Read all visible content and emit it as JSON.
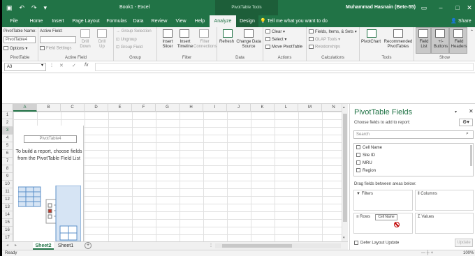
{
  "titlebar": {
    "doc_title": "Book1 - Excel",
    "context_title": "PivotTable Tools",
    "user_name": "Muhammad Hasnain (Bete-55)",
    "qat": [
      "save-icon",
      "undo-icon",
      "redo-icon"
    ],
    "window_buttons": [
      "restore-ribbon-icon",
      "minimize-icon",
      "maximize-icon",
      "close-icon"
    ]
  },
  "tabs": [
    "File",
    "Home",
    "Insert",
    "Page Layout",
    "Formulas",
    "Data",
    "Review",
    "View",
    "Help",
    "Analyze",
    "Design"
  ],
  "active_tab": "Analyze",
  "tell_me": "Tell me what you want to do",
  "share": "Share",
  "ribbon": {
    "pivottable": {
      "name_label": "PivotTable Name:",
      "name_value": "PivotTable4",
      "options": "Options",
      "group": "PivotTable"
    },
    "active_field": {
      "label": "Active Field:",
      "field_settings": "Field Settings",
      "drill_down": [
        "Drill",
        "Down"
      ],
      "drill_up": [
        "Drill",
        "Up"
      ],
      "group": "Active Field"
    },
    "group_grp": {
      "items": [
        "Group Selection",
        "Ungroup",
        "Group Field"
      ],
      "group": "Group"
    },
    "filter": {
      "insert_slicer": [
        "Insert",
        "Slicer"
      ],
      "insert_timeline": [
        "Insert",
        "Timeline"
      ],
      "filter_connections": [
        "Filter",
        "Connections"
      ],
      "group": "Filter"
    },
    "data": {
      "refresh": "Refresh",
      "change_source": [
        "Change Data",
        "Source"
      ],
      "group": "Data"
    },
    "actions": {
      "items": [
        "Clear",
        "Select",
        "Move PivotTable"
      ],
      "group": "Actions"
    },
    "calculations": {
      "items": [
        "Fields, Items, & Sets",
        "OLAP Tools",
        "Relationships"
      ],
      "group": "Calculations"
    },
    "tools": {
      "pivotchart": "PivotChart",
      "recommended": [
        "Recommended",
        "PivotTables"
      ],
      "group": "Tools"
    },
    "show": {
      "field_list": [
        "Field",
        "List"
      ],
      "buttons": [
        "+/-",
        "Buttons"
      ],
      "headers": [
        "Field",
        "Headers"
      ],
      "group": "Show"
    }
  },
  "formula_bar": {
    "name_box": "A3",
    "cancel": "✕",
    "enter": "✓",
    "fx": "fx"
  },
  "grid": {
    "columns": [
      "A",
      "B",
      "C",
      "D",
      "E",
      "F",
      "G",
      "H",
      "I",
      "J",
      "K",
      "L",
      "M",
      "N"
    ],
    "rows": [
      "1",
      "2",
      "3",
      "4",
      "5",
      "6",
      "7",
      "8",
      "9",
      "10",
      "11",
      "12",
      "13",
      "14",
      "15",
      "16",
      "17"
    ],
    "selected_column": "A",
    "selected_row": "3"
  },
  "pivot_placeholder": {
    "name": "PivotTable4",
    "message": "To build a report, choose fields from the PivotTable Field List"
  },
  "sheets": [
    "Sheet2",
    "Sheet1"
  ],
  "active_sheet": "Sheet2",
  "status": {
    "ready": "Ready",
    "zoom": "100%"
  },
  "pane": {
    "title": "PivotTable Fields",
    "subtitle": "Choose fields to add to report:",
    "search_placeholder": "Search",
    "fields": [
      "Cell Name",
      "Site ID",
      "MRU",
      "Region"
    ],
    "drag_msg": "Drag fields between areas below:",
    "areas": {
      "filters": "Filters",
      "columns": "Columns",
      "rows": "Rows",
      "values": "Values"
    },
    "row_chip": "Cell Name",
    "defer": "Defer Layout Update",
    "update": "Update"
  },
  "colors": {
    "excel_green": "#217346",
    "ribbon_bg": "#f3f3f3",
    "nodrop": "#c00000"
  }
}
